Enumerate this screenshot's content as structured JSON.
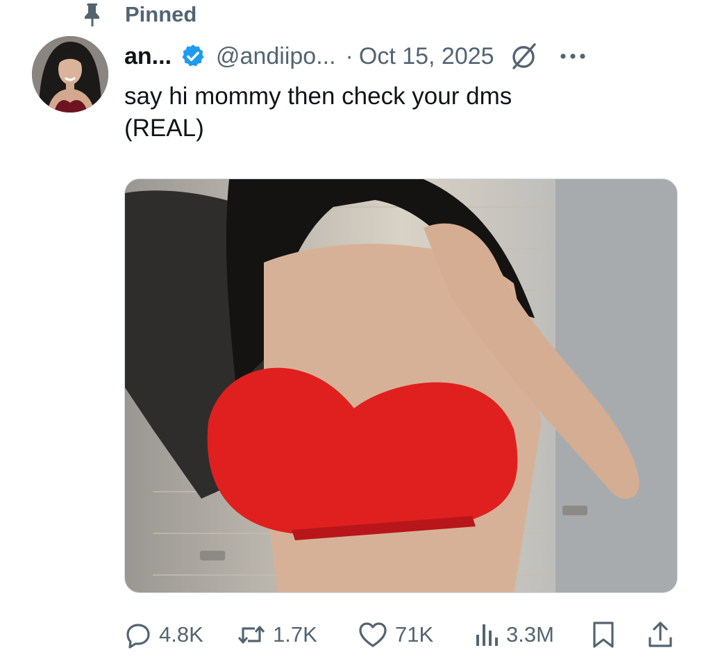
{
  "pinned": {
    "label": "Pinned",
    "icon": "pin-icon"
  },
  "author": {
    "display_name": "an...",
    "handle": "@andiipo...",
    "verified_icon": "verified-badge-icon",
    "avatar_icon": "avatar"
  },
  "tweet": {
    "separator": "·",
    "date": "Oct 15, 2025",
    "text_line1": "say hi mommy then check your dms",
    "text_line2": "(REAL)",
    "grok_icon": "grok-icon",
    "more_icon": "more-icon"
  },
  "actions": {
    "replies": "4.8K",
    "reposts": "1.7K",
    "likes": "71K",
    "views": "3.3M",
    "icons": [
      "reply-icon",
      "repost-icon",
      "like-icon",
      "views-icon",
      "bookmark-icon",
      "share-icon"
    ]
  },
  "colors": {
    "text": "#0f1419",
    "secondary": "#536471",
    "verified_blue": "#1d9bf0",
    "border": "#cfd9de"
  }
}
